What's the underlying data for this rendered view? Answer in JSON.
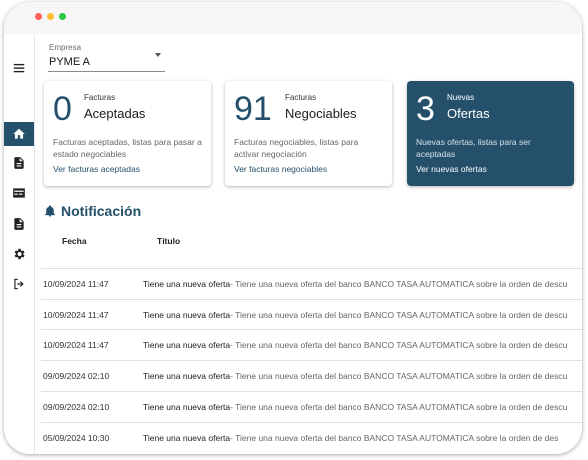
{
  "header": {
    "company_label": "Empresa",
    "company_value": "PYME A"
  },
  "cards": [
    {
      "count": "3",
      "small": "Nuevas",
      "big": "Ofertas",
      "description": "Nuevas ofertas, listas para ser aceptadas",
      "link": "Ver nuevas ofertas"
    },
    {
      "count": "91",
      "small": "Facturas",
      "big": "Negociables",
      "description": "Facturas negociables, listas para activar negociación",
      "link": "Ver facturas negociables"
    },
    {
      "count": "0",
      "small": "Facturas",
      "big": "Aceptadas",
      "description": "Facturas aceptadas, listas para pasar a estado negociables",
      "link": "Ver facturas aceptadas"
    }
  ],
  "notifications": {
    "title": "Notificación",
    "columns": [
      "Fecha",
      "Título"
    ],
    "rows": [
      {
        "date": "10/09/2024 11:47",
        "title": "Tiene una nueva oferta",
        "message": "- Tiene una nueva oferta del banco BANCO TASA AUTOMATICA sobre la orden de descu"
      },
      {
        "date": "10/09/2024 11:47",
        "title": "Tiene una nueva oferta",
        "message": "- Tiene una nueva oferta del banco BANCO TASA AUTOMATICA sobre la orden de descu"
      },
      {
        "date": "10/09/2024 11:47",
        "title": "Tiene una nueva oferta",
        "message": "- Tiene una nueva oferta del banco BANCO TASA AUTOMATICA sobre la orden de descu"
      },
      {
        "date": "09/09/2024 02:10",
        "title": "Tiene una nueva oferta",
        "message": "- Tiene una nueva oferta del banco BANCO TASA AUTOMATICA sobre la orden de descu"
      },
      {
        "date": "09/09/2024 02:10",
        "title": "Tiene una nueva oferta",
        "message": "- Tiene una nueva oferta del banco BANCO TASA AUTOMATICA sobre la orden de descu"
      },
      {
        "date": "05/09/2024 10:30",
        "title": "Tiene una nueva oferta",
        "message": "- Tiene una nueva oferta del banco BANCO TASA AUTOMATICA sobre la orden de des"
      }
    ]
  },
  "colors": {
    "primary": "#24506c",
    "window_red": "#ff5f57",
    "window_yellow": "#febc2e",
    "window_green": "#28c840"
  },
  "icons": [
    "menu-icon",
    "home-icon",
    "document-icon",
    "card-icon",
    "document-icon",
    "gear-icon",
    "logout-icon",
    "bell-icon"
  ]
}
